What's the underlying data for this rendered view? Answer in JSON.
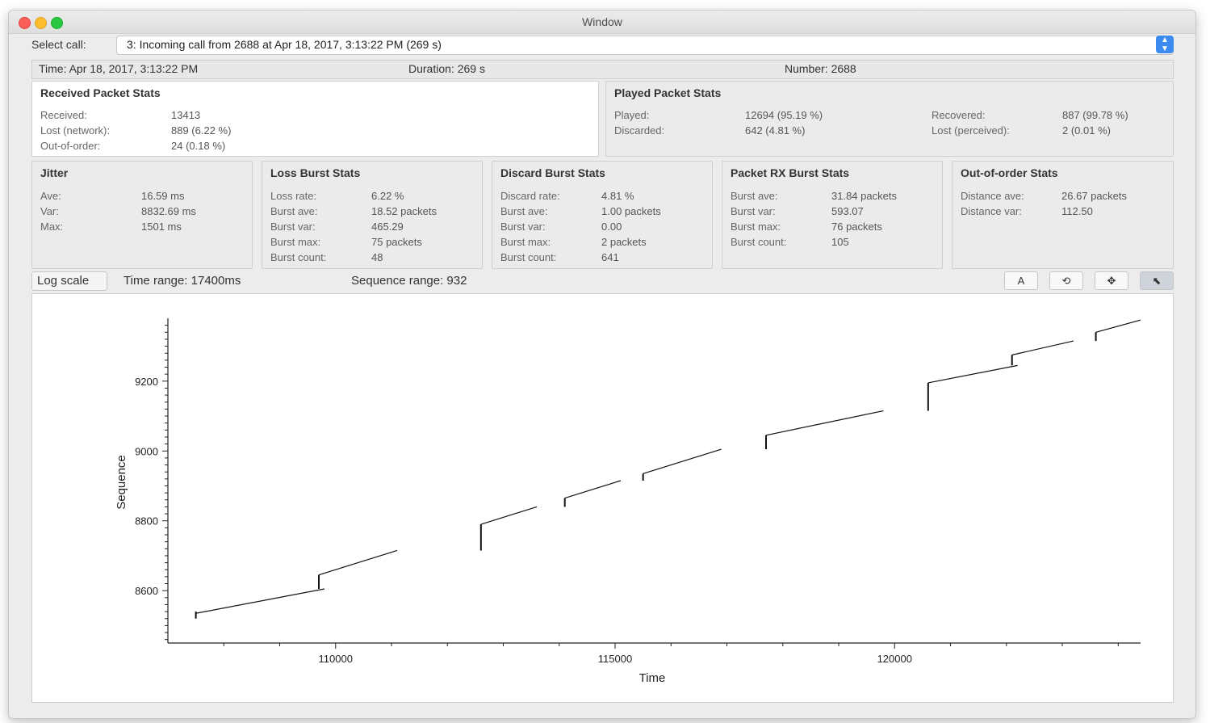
{
  "window": {
    "title": "Window"
  },
  "call_select": {
    "label": "Select call:",
    "value": "3: Incoming call from 2688 at Apr 18, 2017, 3:13:22 PM (269 s)"
  },
  "info": {
    "time": "Time: Apr 18, 2017, 3:13:22 PM",
    "duration": "Duration: 269 s",
    "number": "Number: 2688"
  },
  "received": {
    "title": "Received Packet Stats",
    "rows": [
      {
        "label": "Received:",
        "value": "13413"
      },
      {
        "label": "Lost (network):",
        "value": "889 (6.22 %)"
      },
      {
        "label": "Out-of-order:",
        "value": "24 (0.18 %)"
      }
    ]
  },
  "played": {
    "title": "Played Packet Stats",
    "rows": [
      {
        "label": "Played:",
        "value": "12694 (95.19 %)"
      },
      {
        "label": "Discarded:",
        "value": "642 (4.81 %)"
      },
      {
        "label": "Recovered:",
        "value": "887 (99.78 %)"
      },
      {
        "label": "Lost (perceived):",
        "value": "2 (0.01 %)"
      }
    ]
  },
  "jitter": {
    "title": "Jitter",
    "rows": [
      {
        "label": "Ave:",
        "value": "16.59 ms"
      },
      {
        "label": "Var:",
        "value": "8832.69 ms"
      },
      {
        "label": "Max:",
        "value": "1501 ms"
      }
    ]
  },
  "loss_burst": {
    "title": "Loss Burst Stats",
    "rows": [
      {
        "label": "Loss rate:",
        "value": "6.22 %"
      },
      {
        "label": "Burst ave:",
        "value": "18.52 packets"
      },
      {
        "label": "Burst var:",
        "value": "465.29"
      },
      {
        "label": "Burst max:",
        "value": "75 packets"
      },
      {
        "label": "Burst count:",
        "value": "48"
      }
    ]
  },
  "discard_burst": {
    "title": "Discard Burst Stats",
    "rows": [
      {
        "label": "Discard rate:",
        "value": "4.81 %"
      },
      {
        "label": "Burst ave:",
        "value": "1.00 packets"
      },
      {
        "label": "Burst var:",
        "value": "0.00"
      },
      {
        "label": "Burst max:",
        "value": "2 packets"
      },
      {
        "label": "Burst count:",
        "value": "641"
      }
    ]
  },
  "rx_burst": {
    "title": "Packet RX Burst Stats",
    "rows": [
      {
        "label": "Burst ave:",
        "value": "31.84 packets"
      },
      {
        "label": "Burst var:",
        "value": "593.07"
      },
      {
        "label": "Burst max:",
        "value": "76 packets"
      },
      {
        "label": "Burst count:",
        "value": "105"
      }
    ]
  },
  "ooo": {
    "title": "Out-of-order Stats",
    "rows": [
      {
        "label": "Distance ave:",
        "value": "26.67 packets"
      },
      {
        "label": "Distance var:",
        "value": "112.50"
      }
    ]
  },
  "plot_toolbar": {
    "log_scale": "Log scale",
    "time_range": "Time range: 17400ms",
    "sequence_range": "Sequence range: 932",
    "tools": [
      {
        "name": "text-tool-icon",
        "glyph": "A"
      },
      {
        "name": "reset-zoom-icon",
        "glyph": "⟲"
      },
      {
        "name": "pan-icon",
        "glyph": "✥"
      },
      {
        "name": "select-pointer-icon",
        "glyph": "⬉"
      }
    ]
  },
  "chart_data": {
    "type": "line",
    "xlabel": "Time",
    "ylabel": "Sequence",
    "xlim": [
      107000,
      124400
    ],
    "ylim": [
      8450,
      9380
    ],
    "x_ticks": [
      110000,
      115000,
      120000
    ],
    "y_ticks": [
      8600,
      8800,
      9000,
      9200
    ],
    "segments": [
      {
        "x": [
          107500,
          109800
        ],
        "y": [
          8535,
          8605
        ]
      },
      {
        "x": [
          109700,
          111100
        ],
        "y": [
          8645,
          8715
        ]
      },
      {
        "x": [
          112600,
          113600
        ],
        "y": [
          8790,
          8840
        ]
      },
      {
        "x": [
          114100,
          115100
        ],
        "y": [
          8865,
          8915
        ]
      },
      {
        "x": [
          115500,
          116900
        ],
        "y": [
          8935,
          9005
        ]
      },
      {
        "x": [
          117700,
          119800
        ],
        "y": [
          9045,
          9115
        ]
      },
      {
        "x": [
          120600,
          122200
        ],
        "y": [
          9195,
          9245
        ]
      },
      {
        "x": [
          122100,
          123200
        ],
        "y": [
          9275,
          9315
        ]
      },
      {
        "x": [
          123600,
          124400
        ],
        "y": [
          9340,
          9375
        ]
      }
    ],
    "drops": [
      {
        "x": 107500,
        "y": [
          8520,
          8540
        ]
      },
      {
        "x": 109700,
        "y": [
          8605,
          8645
        ]
      },
      {
        "x": 112600,
        "y": [
          8715,
          8790
        ]
      },
      {
        "x": 114100,
        "y": [
          8840,
          8865
        ]
      },
      {
        "x": 115500,
        "y": [
          8915,
          8935
        ]
      },
      {
        "x": 117700,
        "y": [
          9005,
          9045
        ]
      },
      {
        "x": 120600,
        "y": [
          9115,
          9195
        ]
      },
      {
        "x": 122100,
        "y": [
          9245,
          9275
        ]
      },
      {
        "x": 123600,
        "y": [
          9315,
          9340
        ]
      }
    ]
  }
}
